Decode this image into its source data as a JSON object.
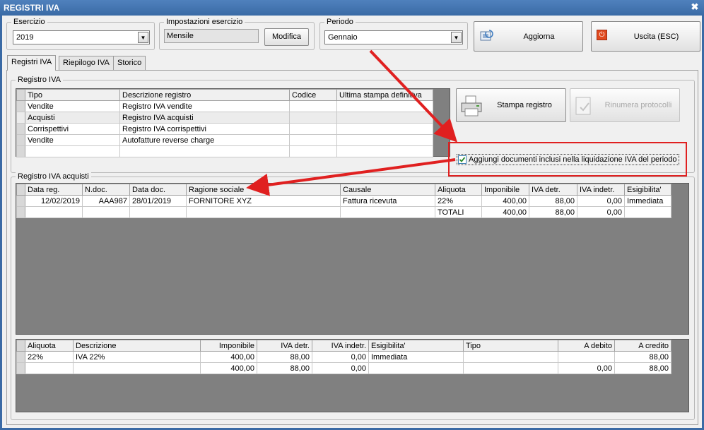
{
  "window": {
    "title": "REGISTRI IVA",
    "close": "✖"
  },
  "esercizio": {
    "legend": "Esercizio",
    "value": "2019"
  },
  "impostazioni": {
    "legend": "Impostazioni esercizio",
    "value": "Mensile",
    "button": "Modifica"
  },
  "periodo": {
    "legend": "Periodo",
    "value": "Gennaio"
  },
  "actions": {
    "aggiorna": "Aggiorna",
    "uscita": "Uscita (ESC)"
  },
  "tabs": [
    {
      "label": "Registri IVA",
      "active": true
    },
    {
      "label": "Riepilogo IVA",
      "active": false
    },
    {
      "label": "Storico",
      "active": false
    }
  ],
  "registri": {
    "legend": "Registro IVA",
    "columns": [
      "Tipo",
      "Descrizione registro",
      "Codice",
      "Ultima stampa definitiva"
    ],
    "rows": [
      [
        "Vendite",
        "Registro IVA vendite",
        "",
        ""
      ],
      [
        "Acquisti",
        "Registro IVA acquisti",
        "",
        ""
      ],
      [
        "Corrispettivi",
        "Registro IVA corrispettivi",
        "",
        ""
      ],
      [
        "Vendite",
        "Autofatture reverse charge",
        "",
        ""
      ]
    ],
    "stampa": "Stampa registro",
    "rinumera": "Rinumera protocolli",
    "checkbox_label": "Aggiungi documenti inclusi nella liquidazione IVA del periodo",
    "checkbox_checked": true
  },
  "acquisti": {
    "legend": "Registro IVA acquisti",
    "columns": [
      "Data reg.",
      "N.doc.",
      "Data doc.",
      "Ragione sociale",
      "Causale",
      "Aliquota",
      "Imponibile",
      "IVA detr.",
      "IVA indetr.",
      "Esigibilita'"
    ],
    "rows": [
      [
        "12/02/2019",
        "AAA987",
        "28/01/2019",
        "FORNITORE XYZ",
        "Fattura ricevuta",
        "22%",
        "400,00",
        "88,00",
        "0,00",
        "Immediata"
      ],
      [
        "",
        "",
        "",
        "",
        "",
        "TOTALI",
        "400,00",
        "88,00",
        "0,00",
        ""
      ]
    ]
  },
  "riepilogo": {
    "columns": [
      "Aliquota",
      "Descrizione",
      "Imponibile",
      "IVA detr.",
      "IVA indetr.",
      "Esigibilita'",
      "Tipo",
      "A debito",
      "A credito"
    ],
    "rows": [
      [
        "22%",
        "IVA 22%",
        "400,00",
        "88,00",
        "0,00",
        "Immediata",
        "",
        "",
        "88,00"
      ],
      [
        "",
        "",
        "400,00",
        "88,00",
        "0,00",
        "",
        "",
        "0,00",
        "88,00"
      ]
    ]
  },
  "colors": {
    "title_bar": "#3a6aa5",
    "annotation": "#e02020",
    "grid_background": "#808080"
  }
}
